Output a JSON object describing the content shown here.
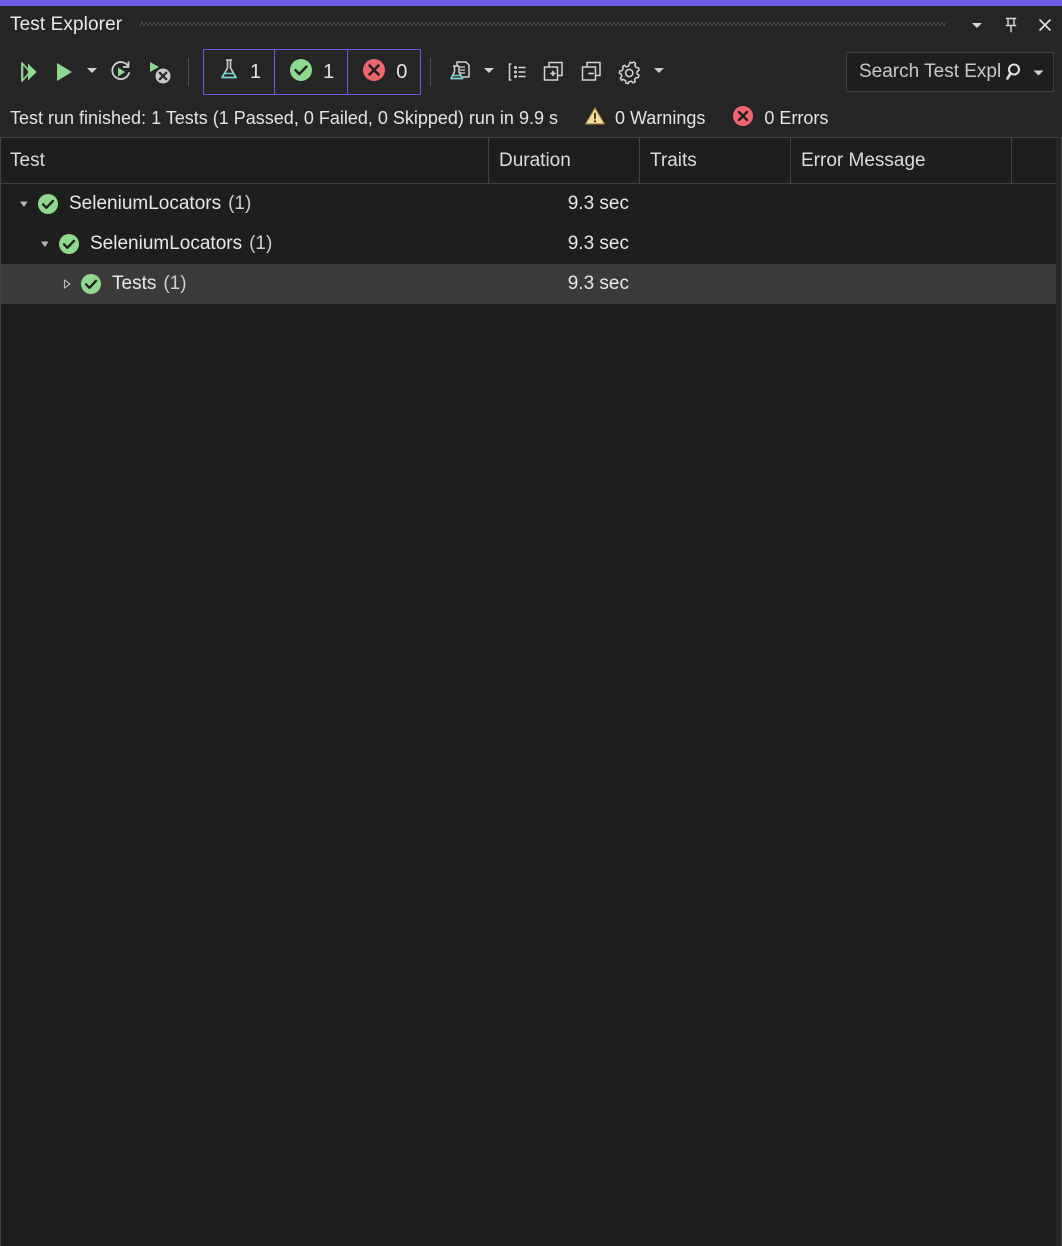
{
  "window": {
    "title": "Test Explorer",
    "accent_color": "#6c5ce7",
    "background": "#1e1e1e",
    "controls": [
      {
        "name": "dropdown",
        "label": "▼"
      },
      {
        "name": "pin",
        "label": "Pin"
      },
      {
        "name": "close",
        "label": "✕"
      }
    ]
  },
  "toolbar": {
    "buttons": [
      {
        "name": "run-all-tests",
        "icon": "run-all-icon",
        "tooltip": "Run All Tests"
      },
      {
        "name": "run",
        "icon": "run-icon",
        "tooltip": "Run"
      },
      {
        "name": "run-dropdown",
        "icon": "chevron-down-icon",
        "tooltip": "Run dropdown"
      },
      {
        "name": "repeat-last-run",
        "icon": "repeat-run-icon",
        "tooltip": "Repeat Last Run"
      },
      {
        "name": "cancel-run",
        "icon": "stop-run-icon",
        "tooltip": "Cancel Test Run"
      },
      {
        "name": "test-detail-summary",
        "icon": "test-document-icon",
        "tooltip": "Open Test Detail Summary"
      },
      {
        "name": "summary-dropdown",
        "icon": "chevron-down-icon",
        "tooltip": "Summary options"
      },
      {
        "name": "group-by",
        "icon": "group-list-icon",
        "tooltip": "Group By"
      },
      {
        "name": "expand-all",
        "icon": "expand-all-icon",
        "tooltip": "Expand All"
      },
      {
        "name": "collapse-all",
        "icon": "collapse-all-icon",
        "tooltip": "Collapse All"
      },
      {
        "name": "settings",
        "icon": "gear-icon",
        "tooltip": "Settings"
      },
      {
        "name": "settings-dropdown",
        "icon": "chevron-down-icon",
        "tooltip": "Settings options"
      }
    ],
    "counters": [
      {
        "name": "total-tests",
        "icon": "flask-icon",
        "icon_color": "#6fd6d6",
        "value": "1",
        "border_color": "#6c5ce7"
      },
      {
        "name": "passed-tests",
        "icon": "check-circle-icon",
        "icon_color": "#8fd98f",
        "value": "1",
        "border_color": "#6c5ce7"
      },
      {
        "name": "failed-tests",
        "icon": "error-circle-icon",
        "icon_color": "#f0666e",
        "value": "0",
        "border_color": "#6c5ce7"
      }
    ],
    "search": {
      "placeholder": "Search Test Explorer",
      "value": "",
      "icon": "search-icon",
      "caret": "chevron-down-icon"
    }
  },
  "status": {
    "message": "Test run finished: 1 Tests (1 Passed, 0 Failed, 0 Skipped) run in 9.9 s",
    "warnings": {
      "icon": "warning-icon",
      "label": "0 Warnings",
      "color": "#f0d080"
    },
    "errors": {
      "icon": "error-circle-icon",
      "label": "0 Errors",
      "color": "#f0666e"
    }
  },
  "grid": {
    "columns": [
      {
        "name": "test",
        "label": "Test"
      },
      {
        "name": "duration",
        "label": "Duration"
      },
      {
        "name": "traits",
        "label": "Traits"
      },
      {
        "name": "error-message",
        "label": "Error Message"
      }
    ],
    "rows": [
      {
        "name": "row-solution-seleniumlocators",
        "indent": 0,
        "twisty": "expanded",
        "status_icon": "check-circle-icon",
        "label": "SeleniumLocators",
        "count": "(1)",
        "duration": "9.3 sec",
        "traits": "",
        "error_message": "",
        "selected": false
      },
      {
        "name": "row-project-seleniumlocators",
        "indent": 1,
        "twisty": "expanded",
        "status_icon": "check-circle-icon",
        "label": "SeleniumLocators",
        "count": "(1)",
        "duration": "9.3 sec",
        "traits": "",
        "error_message": "",
        "selected": false
      },
      {
        "name": "row-namespace-tests",
        "indent": 2,
        "twisty": "collapsed",
        "status_icon": "check-circle-icon",
        "label": "Tests",
        "count": "(1)",
        "duration": "9.3 sec",
        "traits": "",
        "error_message": "",
        "selected": true
      }
    ]
  }
}
